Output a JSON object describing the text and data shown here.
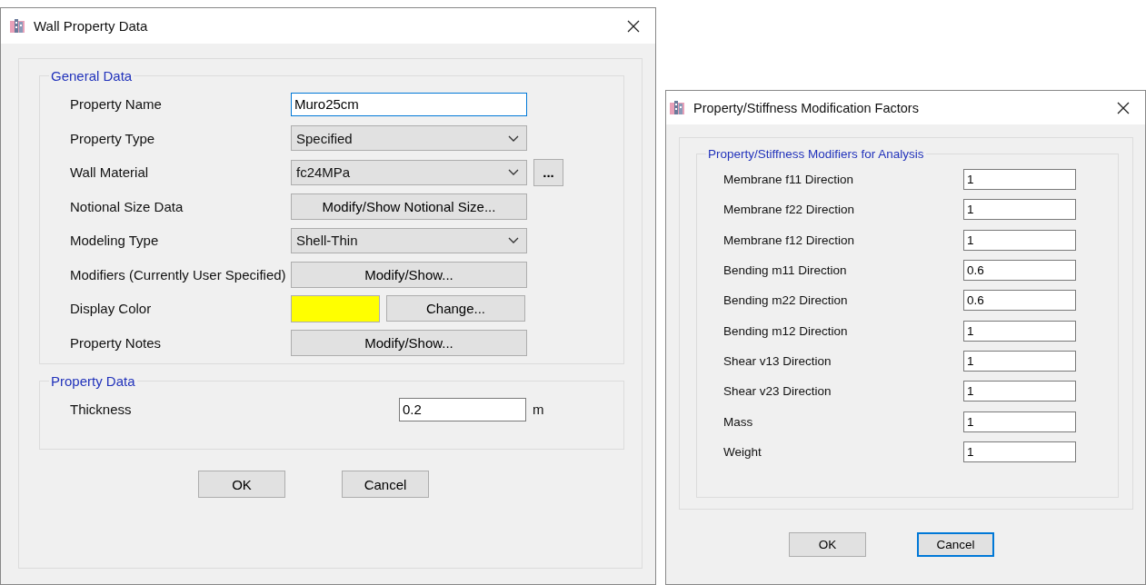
{
  "windows": [
    {
      "title": "Wall Property Data",
      "groups": [
        {
          "title": "General Data",
          "rows": [
            {
              "label": "Property Name",
              "kind": "text",
              "value": "Muro25cm",
              "focused": true
            },
            {
              "label": "Property Type",
              "kind": "select",
              "value": "Specified"
            },
            {
              "label": "Wall Material",
              "kind": "select_more",
              "value": "fc24MPa",
              "more": "..."
            },
            {
              "label": "Notional Size Data",
              "kind": "button",
              "value": "Modify/Show Notional Size..."
            },
            {
              "label": "Modeling Type",
              "kind": "select",
              "value": "Shell-Thin"
            },
            {
              "label": "Modifiers (Currently User Specified)",
              "kind": "button",
              "value": "Modify/Show..."
            },
            {
              "label": "Display Color",
              "kind": "color",
              "color": "#ffff00",
              "value": "Change..."
            },
            {
              "label": "Property Notes",
              "kind": "button",
              "value": "Modify/Show..."
            }
          ]
        },
        {
          "title": "Property Data",
          "rows": [
            {
              "label": "Thickness",
              "kind": "unit",
              "value": "0.2",
              "unit": "m",
              "focused": false
            }
          ]
        }
      ],
      "buttons": [
        {
          "label": "OK",
          "focused": false
        },
        {
          "label": "Cancel",
          "focused": false
        }
      ]
    },
    {
      "title": "Property/Stiffness Modification Factors",
      "groups": [
        {
          "title": "Property/Stiffness Modifiers for Analysis",
          "rows": [
            {
              "label": "Membrane f11 Direction",
              "kind": "text",
              "value": "1",
              "focused": false
            },
            {
              "label": "Membrane f22 Direction",
              "kind": "text",
              "value": "1",
              "focused": false
            },
            {
              "label": "Membrane f12 Direction",
              "kind": "text",
              "value": "1",
              "focused": false
            },
            {
              "label": "Bending m11 Direction",
              "kind": "text",
              "value": "0.6",
              "focused": false
            },
            {
              "label": "Bending m22 Direction",
              "kind": "text",
              "value": "0.6",
              "focused": false
            },
            {
              "label": "Bending m12 Direction",
              "kind": "text",
              "value": "1",
              "focused": false
            },
            {
              "label": "Shear v13 Direction",
              "kind": "text",
              "value": "1",
              "focused": false
            },
            {
              "label": "Shear v23 Direction",
              "kind": "text",
              "value": "1",
              "focused": false
            },
            {
              "label": "Mass",
              "kind": "text",
              "value": "1",
              "focused": false
            },
            {
              "label": "Weight",
              "kind": "text",
              "value": "1",
              "focused": false
            }
          ]
        }
      ],
      "buttons": [
        {
          "label": "OK",
          "focused": false
        },
        {
          "label": "Cancel",
          "focused": true
        }
      ]
    }
  ]
}
